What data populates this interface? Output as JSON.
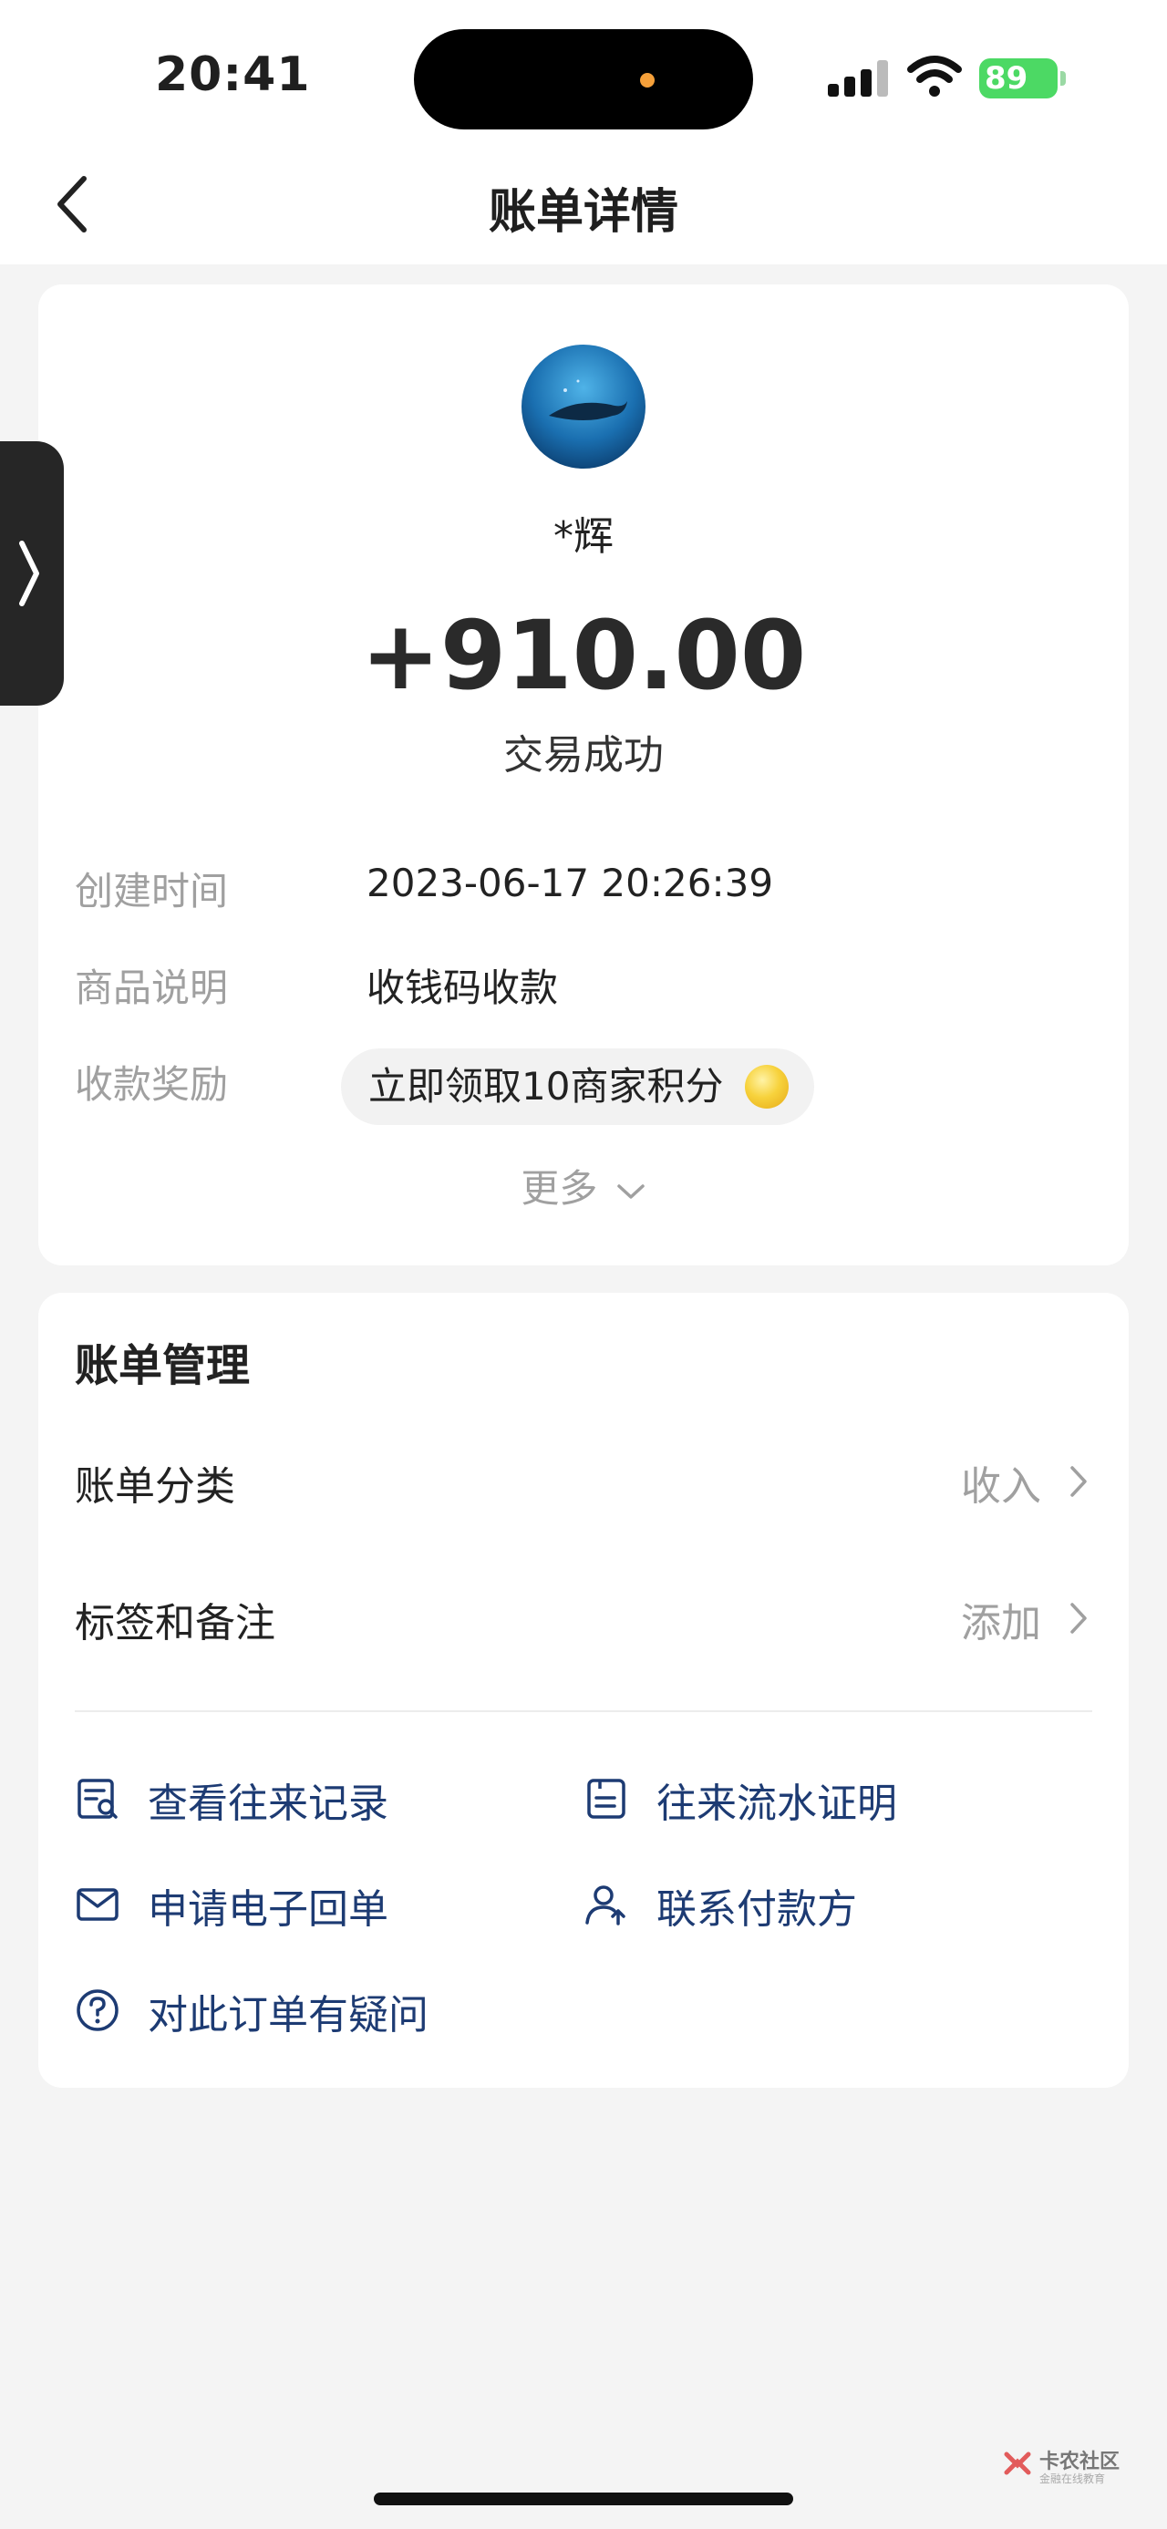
{
  "status_bar": {
    "time": "20:41",
    "battery": "89"
  },
  "nav": {
    "title": "账单详情"
  },
  "transaction": {
    "payer_name": "*辉",
    "amount": "+910.00",
    "status": "交易成功",
    "details": [
      {
        "label": "创建时间",
        "value": "2023-06-17 20:26:39"
      },
      {
        "label": "商品说明",
        "value": "收钱码收款"
      },
      {
        "label": "收款奖励",
        "value": "立即领取10商家积分"
      }
    ],
    "more": "更多"
  },
  "management": {
    "title": "账单管理",
    "rows": [
      {
        "label": "账单分类",
        "value": "收入"
      },
      {
        "label": "标签和备注",
        "value": "添加"
      }
    ],
    "actions": [
      {
        "label": "查看往来记录",
        "icon": "record-search-icon"
      },
      {
        "label": "往来流水证明",
        "icon": "statement-icon"
      },
      {
        "label": "申请电子回单",
        "icon": "envelope-icon"
      },
      {
        "label": "联系付款方",
        "icon": "contact-person-icon"
      },
      {
        "label": "对此订单有疑问",
        "icon": "question-icon"
      }
    ]
  },
  "watermark": {
    "text": "卡农社区",
    "sub": "金融在线教育"
  },
  "colors": {
    "page_bg": "#f4f4f4",
    "card_bg": "#ffffff",
    "action_text": "#1d3b73",
    "muted_text": "#a0a0a0",
    "battery": "#4cd964",
    "island_dot": "#f5a03a"
  }
}
